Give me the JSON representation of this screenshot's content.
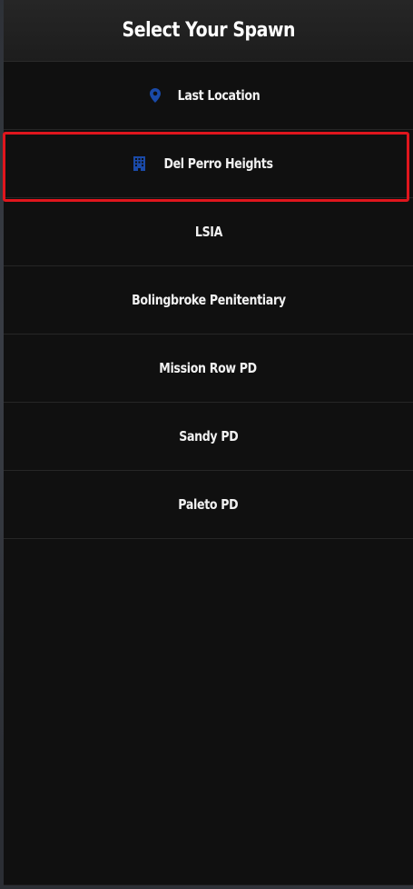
{
  "header": {
    "title": "Select Your Spawn"
  },
  "accent_color": "#1a4aa8",
  "selection_color": "#e0161d",
  "spawns": [
    {
      "label": "Last Location",
      "icon": "map-pin-icon"
    },
    {
      "label": "Del Perro Heights",
      "icon": "building-icon",
      "selected": true
    },
    {
      "label": "LSIA"
    },
    {
      "label": "Bolingbroke Penitentiary"
    },
    {
      "label": "Mission Row PD"
    },
    {
      "label": "Sandy PD"
    },
    {
      "label": "Paleto PD"
    }
  ]
}
